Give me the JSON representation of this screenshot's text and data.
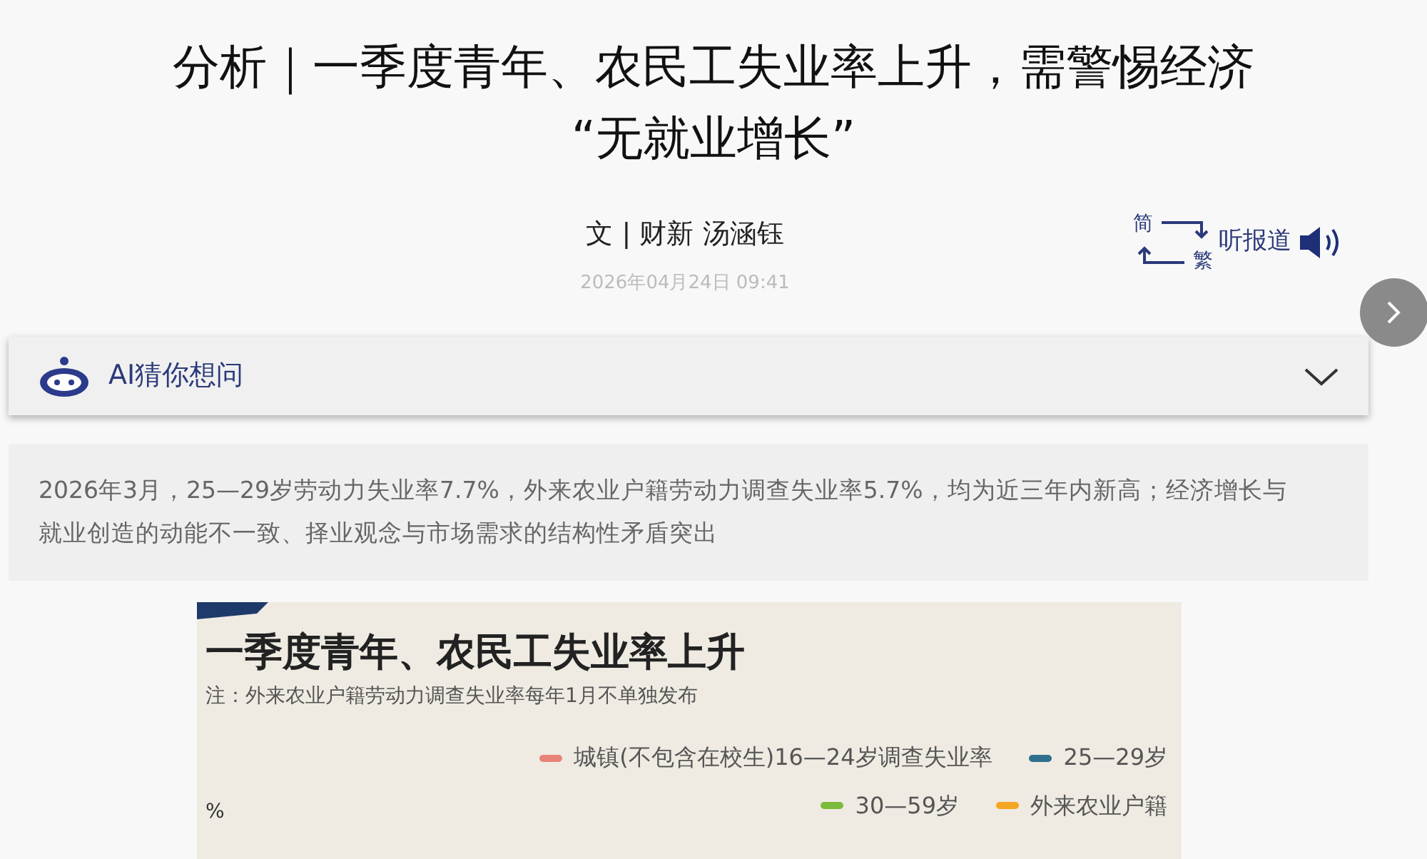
{
  "article": {
    "title_lines": [
      "分析｜一季度青年、农民工失业率上升，需警惕经济",
      "“无就业增长”"
    ],
    "byline": "文 | 财新 汤涵钰",
    "date": "2026年04月24日 09:41"
  },
  "tools": {
    "simplified": "简",
    "traditional": "繁",
    "listen": "听报道"
  },
  "ai_panel": {
    "label": "AI猜你想问",
    "expanded": false
  },
  "summary": "2026年3月，25—29岁劳动力失业率7.7%，外来农业户籍劳动力调查失业率5.7%，均为近三年内新高；经济增长与就业创造的动能不一致、择业观念与市场需求的结构性矛盾突出",
  "figure": {
    "title": "一季度青年、农民工失业率上升",
    "note": "注：外来农业户籍劳动力调查失业率每年1月不单独发布",
    "unit": "%",
    "legend": [
      {
        "label": "城镇(不包含在校生)16—24岁调查失业率",
        "color": "#e8837a"
      },
      {
        "label": "25—29岁",
        "color": "#2e6f8e"
      },
      {
        "label": "30—59岁",
        "color": "#7cba3c"
      },
      {
        "label": "外来农业户籍",
        "color": "#f5a623"
      }
    ]
  }
}
